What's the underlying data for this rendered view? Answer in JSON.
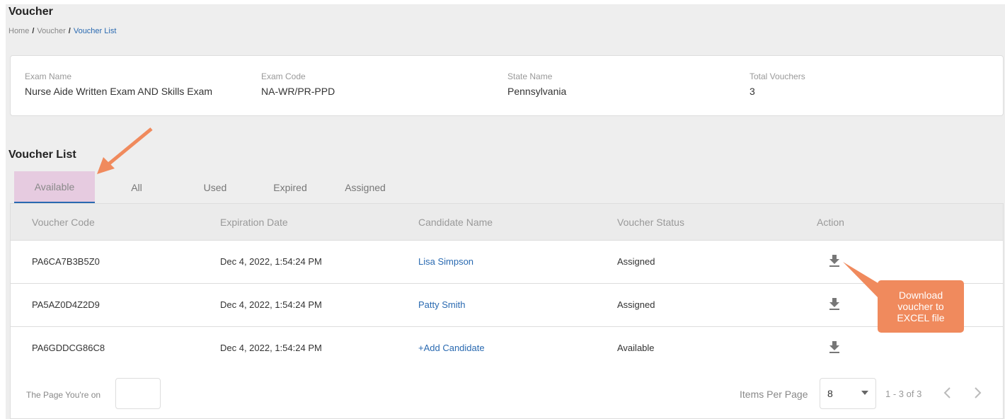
{
  "page": {
    "title": "Voucher",
    "breadcrumb": {
      "home": "Home",
      "sep": "/",
      "voucher": "Voucher",
      "current": "Voucher List"
    }
  },
  "exam_info": {
    "exam_name_label": "Exam Name",
    "exam_name": "Nurse Aide Written Exam AND Skills Exam",
    "exam_code_label": "Exam Code",
    "exam_code": "NA-WR/PR-PPD",
    "state_name_label": "State Name",
    "state_name": "Pennsylvania",
    "total_vouchers_label": "Total Vouchers",
    "total_vouchers": "3"
  },
  "voucher_list": {
    "title": "Voucher List",
    "tabs": [
      {
        "label": "Available",
        "active": true
      },
      {
        "label": "All",
        "active": false
      },
      {
        "label": "Used",
        "active": false
      },
      {
        "label": "Expired",
        "active": false
      },
      {
        "label": "Assigned",
        "active": false
      }
    ],
    "columns": [
      "Voucher Code",
      "Expiration Date",
      "Candidate Name",
      "Voucher Status",
      "Action"
    ],
    "rows": [
      {
        "code": "PA6CA7B3B5Z0",
        "expiration": "Dec 4, 2022, 1:54:24 PM",
        "candidate": "Lisa Simpson",
        "status": "Assigned",
        "action_icon": "download-icon"
      },
      {
        "code": "PA5AZ0D4Z2D9",
        "expiration": "Dec 4, 2022, 1:54:24 PM",
        "candidate": "Patty Smith",
        "status": "Assigned",
        "action_icon": "download-icon"
      },
      {
        "code": "PA6GDDCG86C8",
        "expiration": "Dec 4, 2022, 1:54:24 PM",
        "candidate": "+Add Candidate",
        "status": "Available",
        "action_icon": "download-icon"
      }
    ]
  },
  "pagination": {
    "page_label": "The Page You're on",
    "page_input_value": "",
    "items_per_page_label": "Items Per Page",
    "items_per_page": "8",
    "range": "1 - 3 of 3",
    "prev_icon": "chevron-left-icon",
    "next_icon": "chevron-right-icon"
  },
  "annotation": {
    "callout": "Download voucher to EXCEL file",
    "color": "#f08a5d"
  },
  "colors": {
    "link": "#2a6ab1",
    "active_tab_bg": "#e6cbe0",
    "page_bg": "#eeeeee"
  }
}
